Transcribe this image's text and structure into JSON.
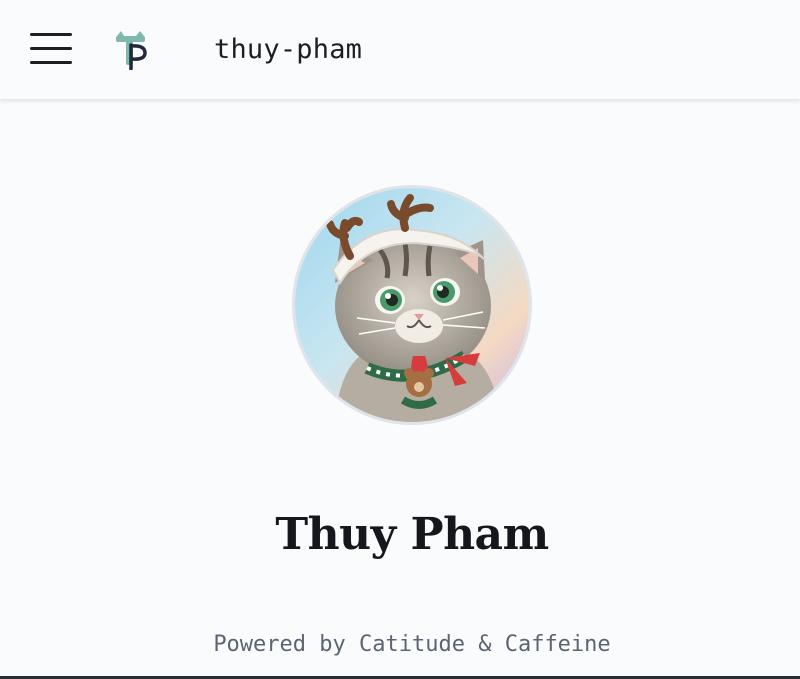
{
  "header": {
    "menu_icon": "hamburger-menu-icon",
    "logo_icon": "tp-cat-logo-icon",
    "site_name": "thuy-pham"
  },
  "profile": {
    "avatar_icon": "cat-avatar-reindeer-antlers",
    "name": "Thuy Pham"
  },
  "footer": {
    "powered_by": "Powered by Catitude & Caffeine"
  },
  "colors": {
    "background": "#fafbfc",
    "text_primary": "#14171c",
    "text_muted": "#5b6472",
    "logo_teal": "#7fb8ad",
    "logo_navy": "#1f2a3a"
  }
}
